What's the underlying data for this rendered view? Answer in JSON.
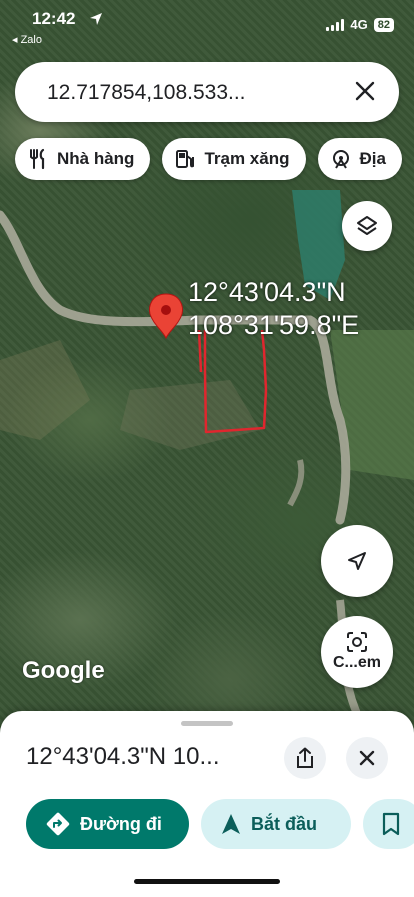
{
  "status_bar": {
    "time": "12:42",
    "back_app": "◂ Zalo",
    "network": "4G",
    "battery": "82"
  },
  "search": {
    "value": "12.717854,108.533..."
  },
  "chips": [
    {
      "label": "Nhà hàng",
      "icon": "restaurant-icon"
    },
    {
      "label": "Trạm xăng",
      "icon": "gas-station-icon"
    },
    {
      "label": "Địa",
      "icon": "attraction-icon"
    }
  ],
  "map": {
    "coord_line1": "12°43'04.3\"N",
    "coord_line2": "108°31'59.8\"E",
    "google_label": "Google",
    "lens_label": "C...em",
    "pin_color": "#ea4335",
    "drawing_color": "#e0262e"
  },
  "sheet": {
    "title": "12°43'04.3\"N 10...",
    "directions_label": "Đường đi",
    "start_label": "Bắt đầu"
  },
  "colors": {
    "accent": "#00796b",
    "secondary_button": "#d6f1f3"
  }
}
